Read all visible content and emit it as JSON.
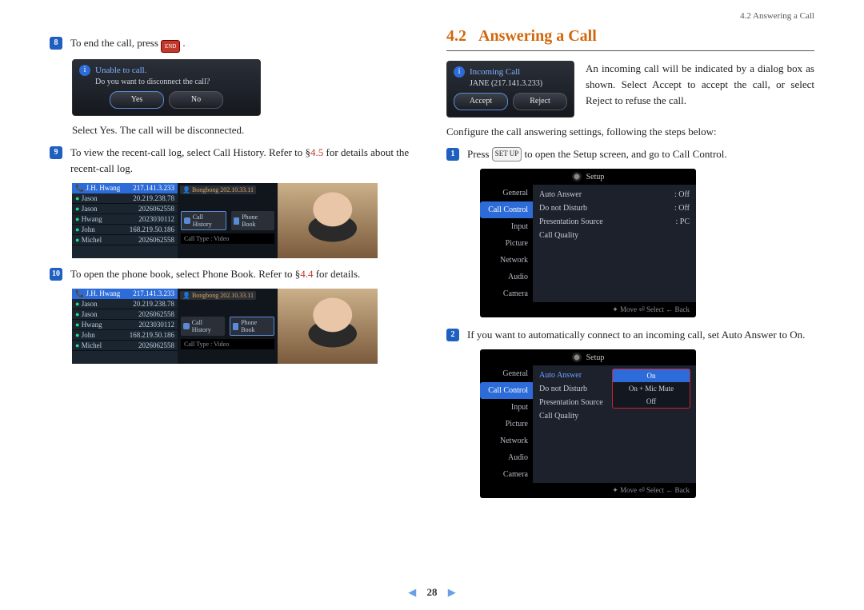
{
  "header": {
    "breadcrumb": "4.2 Answering a Call"
  },
  "left": {
    "step8": {
      "num": "8",
      "text_a": "To end the call, press ",
      "text_b": " .",
      "end_key_label": "END",
      "dialog": {
        "title": "Unable to call.",
        "message": "Do you want to disconnect the call?",
        "yes": "Yes",
        "no": "No"
      },
      "after": "Select Yes. The call will be disconnected."
    },
    "step9": {
      "num": "9",
      "text": "To view the recent-call log, select Call History. Refer to §",
      "ref": "4.5",
      "text2": " for details about the recent-call log."
    },
    "listshot": {
      "header_name": "J.H. Hwang",
      "header_ip": "217.141.3.233",
      "rows": [
        {
          "name": "Jason",
          "num": "20.219.238.78"
        },
        {
          "name": "Jason",
          "num": "2026062558"
        },
        {
          "name": "Hwang",
          "num": "2023030112"
        },
        {
          "name": "John",
          "num": "168.219.50.186"
        },
        {
          "name": "Michel",
          "num": "2026062558"
        }
      ],
      "tag": "Bongbong  202.10.33.11",
      "btn_history": "Call History",
      "btn_phonebook": "Phone Book",
      "footer": "Call Type : Video"
    },
    "step10": {
      "num": "10",
      "text": "To open the phone book, select Phone Book. Refer to §",
      "ref": "4.4",
      "text2": " for details."
    }
  },
  "right": {
    "h2_num": "4.2",
    "h2_title": "Answering a Call",
    "incoming": {
      "title": "Incoming Call",
      "sub": "JANE (217.141.3.233)",
      "accept": "Accept",
      "reject": "Reject",
      "body": "An incoming call will be indicated by a dialog box as shown. Select Accept to accept the call, or select Reject to refuse the call."
    },
    "config_line": "Configure the call answering settings, following the steps below:",
    "step1": {
      "num": "1",
      "a": "Press ",
      "key": "SET UP",
      "b": " to open the Setup screen, and go to Call Control."
    },
    "setup": {
      "title": "Setup",
      "menu": [
        "General",
        "Call Control",
        "Input",
        "Picture",
        "Network",
        "Audio",
        "Camera"
      ],
      "opts": [
        {
          "k": "Auto Answer",
          "v": ": Off"
        },
        {
          "k": "Do not Disturb",
          "v": ": Off"
        },
        {
          "k": "Presentation Source",
          "v": ": PC"
        },
        {
          "k": "Call Quality",
          "v": ""
        }
      ],
      "footer": "✦ Move   ⏎ Select   ← Back"
    },
    "step2": {
      "num": "2",
      "text": "If you want to automatically connect to an incoming call, set Auto Answer to On."
    },
    "setup2": {
      "opts": [
        {
          "k": "Auto Answer",
          "v": ""
        },
        {
          "k": "Do not Disturb",
          "v": ""
        },
        {
          "k": "Presentation Source",
          "v": ""
        },
        {
          "k": "Call Quality",
          "v": ""
        }
      ],
      "popup": [
        "On",
        "On + Mic Mute",
        "Off"
      ]
    }
  },
  "pager": {
    "page": "28"
  }
}
